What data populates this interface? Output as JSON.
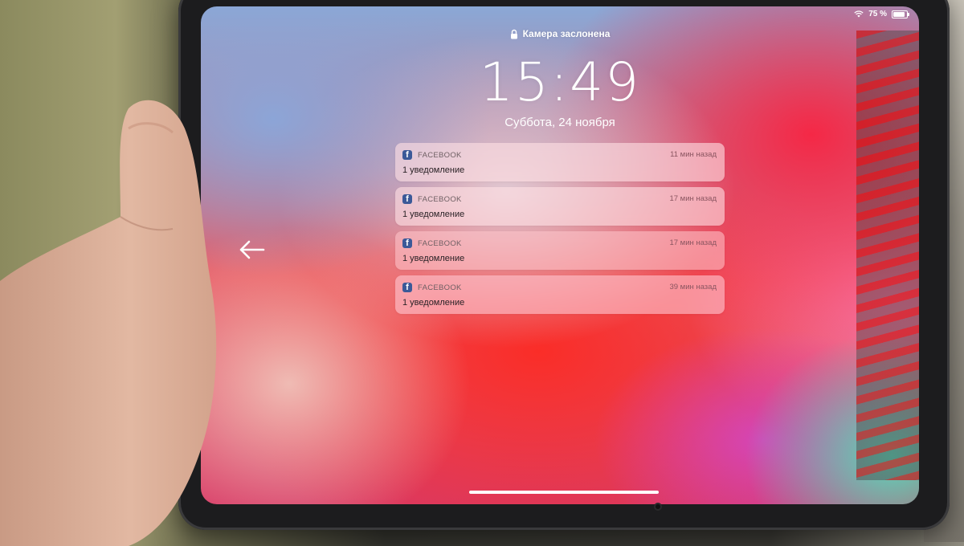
{
  "status_bar": {
    "battery_percent": "75 %",
    "battery_level": 0.75,
    "wifi_icon": "wifi-icon",
    "battery_icon": "battery-icon"
  },
  "lock_screen": {
    "camera_label": "Камера заслонена",
    "lock_icon": "lock-icon",
    "time": "15:49",
    "date": "Суббота, 24 ноября",
    "back_icon": "arrow-left-icon"
  },
  "notifications": [
    {
      "app": "FACEBOOK",
      "time": "11 мин назад",
      "body": "1 уведомление",
      "icon": "facebook-icon"
    },
    {
      "app": "FACEBOOK",
      "time": "17 мин назад",
      "body": "1 уведомление",
      "icon": "facebook-icon"
    },
    {
      "app": "FACEBOOK",
      "time": "17 мин назад",
      "body": "1 уведомление",
      "icon": "facebook-icon"
    },
    {
      "app": "FACEBOOK",
      "time": "39 мин назад",
      "body": "1 уведомление",
      "icon": "facebook-icon"
    }
  ],
  "colors": {
    "facebook_blue": "#3b5998",
    "text_white": "#ffffff"
  }
}
